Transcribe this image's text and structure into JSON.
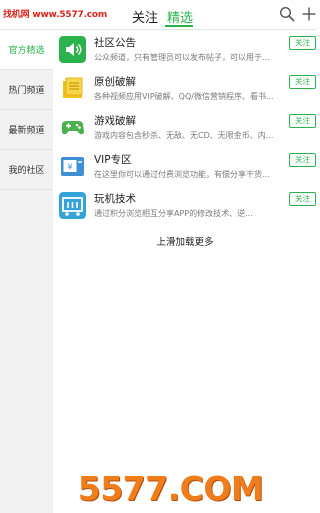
{
  "watermark_top": "找机网 www.5577.com",
  "header": {
    "tabs": [
      {
        "label": "关注",
        "active": false
      },
      {
        "label": "精选",
        "active": true
      }
    ],
    "icons": [
      "search-icon",
      "plus-icon"
    ]
  },
  "sidebar": {
    "items": [
      {
        "label": "官方精选",
        "active": true
      },
      {
        "label": "热门频道",
        "active": false
      },
      {
        "label": "最新频道",
        "active": false
      },
      {
        "label": "我的社区",
        "active": false
      }
    ]
  },
  "channels": [
    {
      "title": "社区公告",
      "desc": "公众频道，只有管理员可以发布帖子，可以用于...",
      "action": "关注",
      "icon": "speaker-icon",
      "color": "#2bb24c"
    },
    {
      "title": "原创破解",
      "desc": "各种视频应用VIP破解、QQ/微信营销程序、看书...",
      "action": "关注",
      "icon": "coins-icon",
      "color": "#f3c21a"
    },
    {
      "title": "游戏破解",
      "desc": "游戏内容包含秒杀、无敌、无CD、无限金币、内...",
      "action": "关注",
      "icon": "gamepad-icon",
      "color": "#4caf50"
    },
    {
      "title": "VIP专区",
      "desc": "在这里你可以通过付费浏览功能，有偿分享干货...",
      "action": "关注",
      "icon": "vip-card-icon",
      "color": "#3f8fd6"
    },
    {
      "title": "玩机技术",
      "desc": "通过积分浏览相互分享APP的修改技术、逆...",
      "action": "关注",
      "icon": "phone-tech-icon",
      "color": "#35a3d8"
    }
  ],
  "load_more": "上滑加载更多",
  "watermark_bottom": "5577.COM",
  "colors": {
    "accent": "#2bb24c",
    "sidebar_bg": "#f1f1f1"
  }
}
